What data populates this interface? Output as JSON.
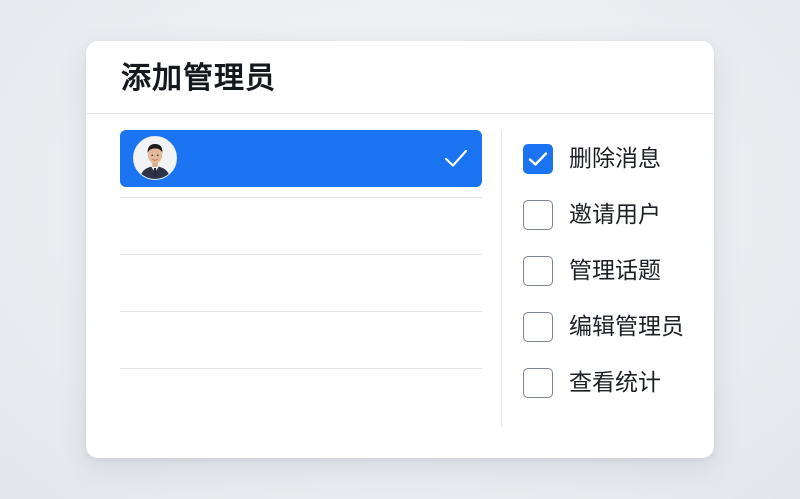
{
  "dialog": {
    "title": "添加管理员"
  },
  "colors": {
    "accent": "#1a73f0",
    "divider": "#e3e6ea",
    "checkbox_border": "#7d8593"
  },
  "user_list": {
    "selected_user": {
      "avatar": "user-avatar-photo",
      "selected": true,
      "check_icon": "check-icon"
    },
    "empty_rows": 4
  },
  "permissions": [
    {
      "label": "删除消息",
      "checked": true
    },
    {
      "label": "邀请用户",
      "checked": false
    },
    {
      "label": "管理话题",
      "checked": false
    },
    {
      "label": "编辑管理员",
      "checked": false
    },
    {
      "label": "查看统计",
      "checked": false
    }
  ]
}
